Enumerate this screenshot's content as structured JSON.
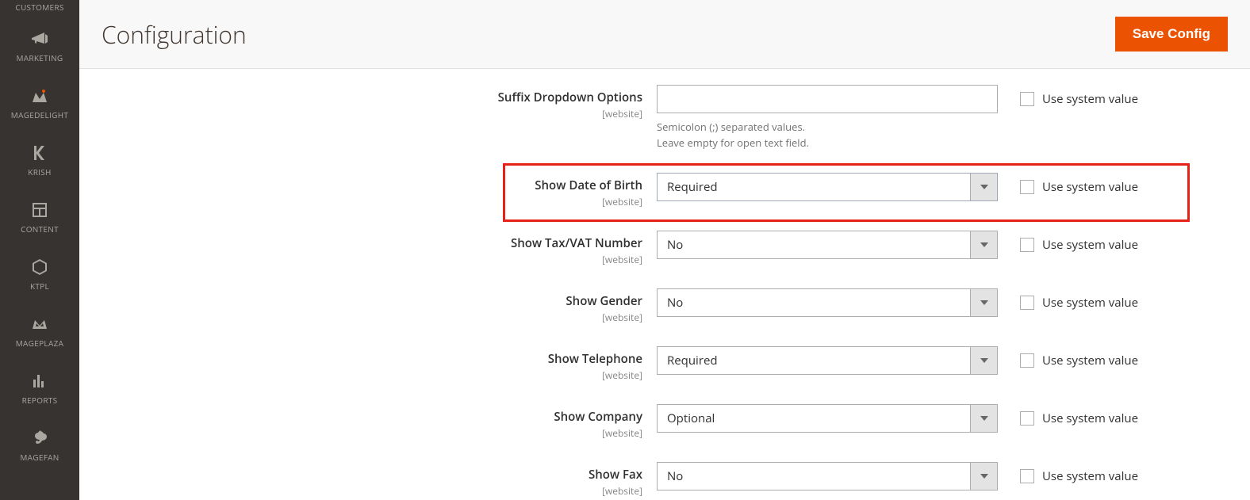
{
  "sidebar": {
    "items": [
      {
        "label": "CUSTOMERS"
      },
      {
        "label": "MARKETING"
      },
      {
        "label": "MAGEDELIGHT"
      },
      {
        "label": "KRISH"
      },
      {
        "label": "CONTENT"
      },
      {
        "label": "KTPL"
      },
      {
        "label": "MAGEPLAZA"
      },
      {
        "label": "REPORTS"
      },
      {
        "label": "MAGEFAN"
      }
    ]
  },
  "header": {
    "title": "Configuration",
    "save_label": "Save Config"
  },
  "fields": {
    "suffix": {
      "label": "Suffix Dropdown Options",
      "scope": "[website]",
      "value": "",
      "helper": "Semicolon (;) separated values.\nLeave empty for open text field.",
      "use_system": "Use system value"
    },
    "dob": {
      "label": "Show Date of Birth",
      "scope": "[website]",
      "value": "Required",
      "use_system": "Use system value"
    },
    "taxvat": {
      "label": "Show Tax/VAT Number",
      "scope": "[website]",
      "value": "No",
      "use_system": "Use system value"
    },
    "gender": {
      "label": "Show Gender",
      "scope": "[website]",
      "value": "No",
      "use_system": "Use system value"
    },
    "telephone": {
      "label": "Show Telephone",
      "scope": "[website]",
      "value": "Required",
      "use_system": "Use system value"
    },
    "company": {
      "label": "Show Company",
      "scope": "[website]",
      "value": "Optional",
      "use_system": "Use system value"
    },
    "fax": {
      "label": "Show Fax",
      "scope": "[website]",
      "value": "No",
      "use_system": "Use system value"
    }
  }
}
